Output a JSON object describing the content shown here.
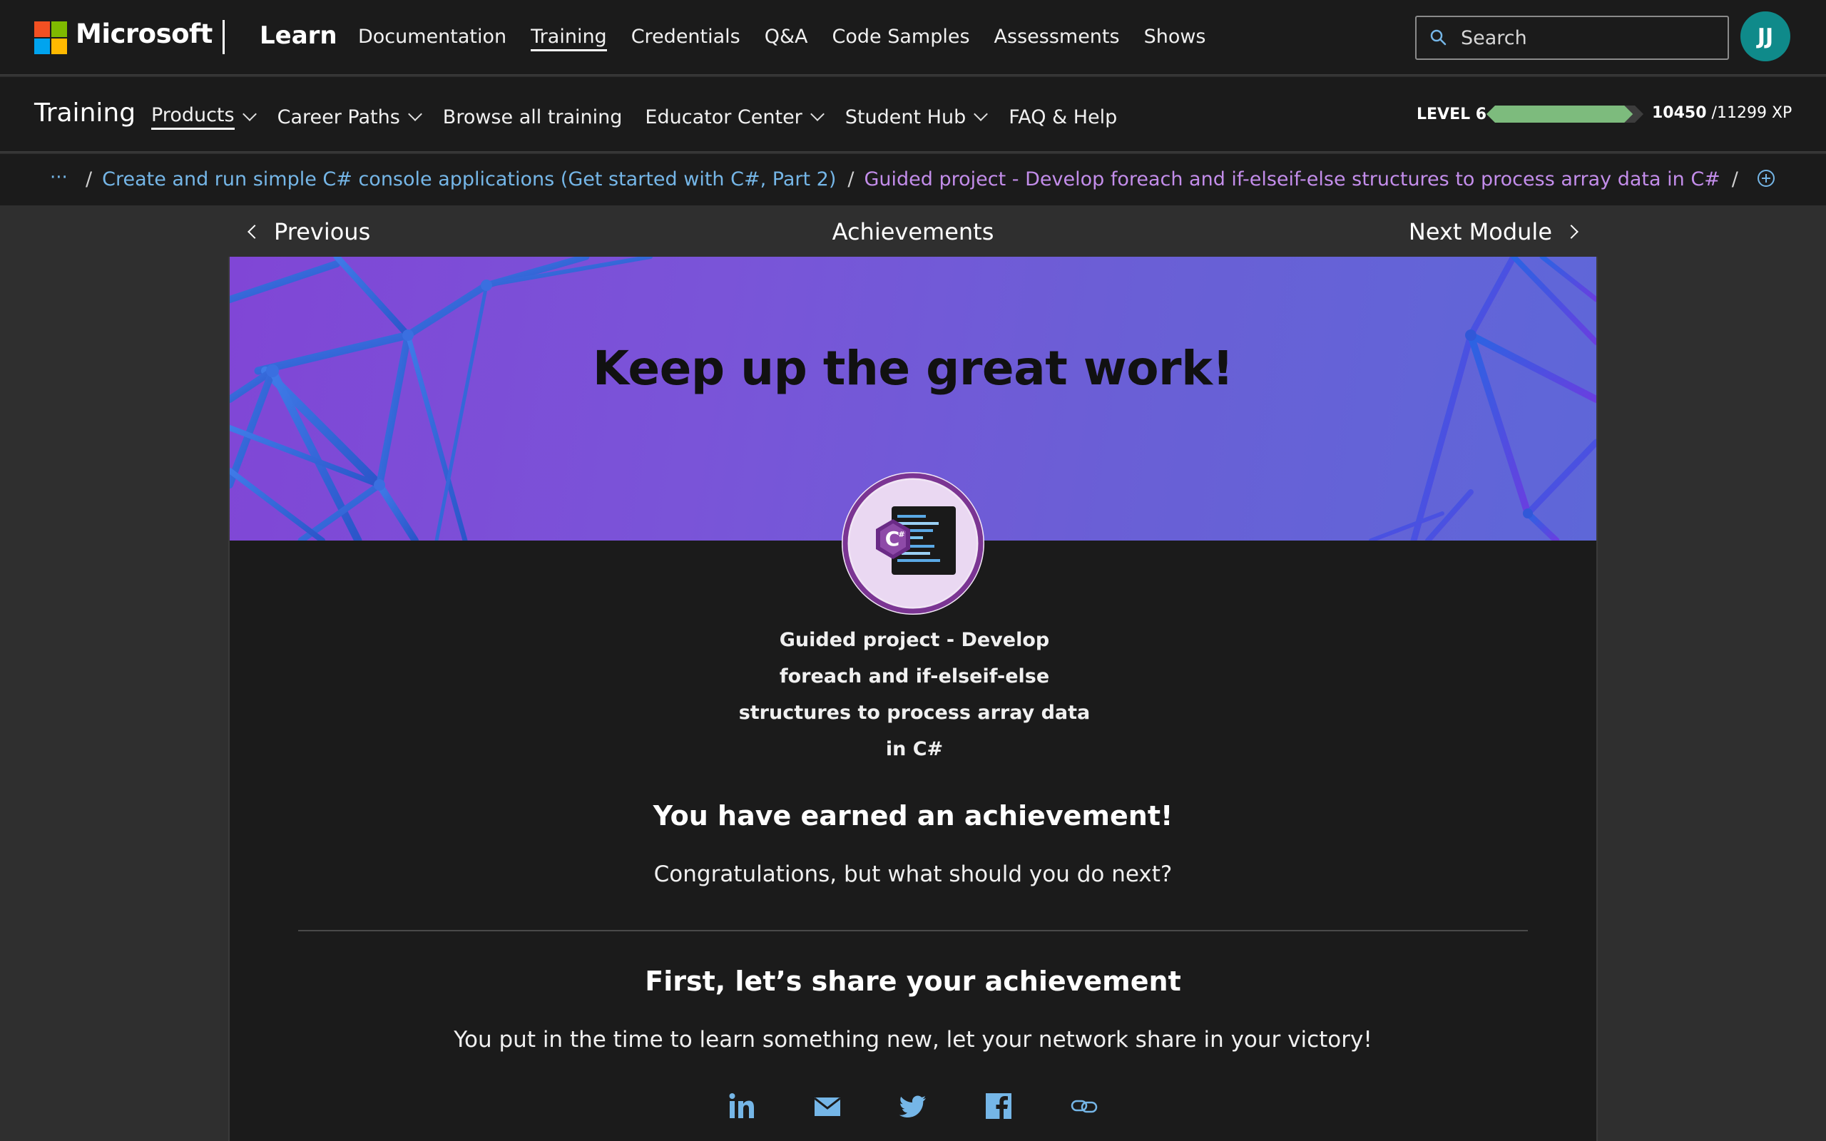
{
  "header": {
    "brand": "Microsoft",
    "product": "Learn",
    "nav": [
      "Documentation",
      "Training",
      "Credentials",
      "Q&A",
      "Code Samples",
      "Assessments",
      "Shows"
    ],
    "active_nav": "Training",
    "search_placeholder": "Search",
    "avatar_initials": "JJ",
    "logo_colors": [
      "#f25022",
      "#7fba00",
      "#00a4ef",
      "#ffb900"
    ]
  },
  "subheader": {
    "title": "Training",
    "items": [
      {
        "label": "Products",
        "dropdown": true,
        "active": true
      },
      {
        "label": "Career Paths",
        "dropdown": true
      },
      {
        "label": "Browse all training",
        "dropdown": false
      },
      {
        "label": "Educator Center",
        "dropdown": true
      },
      {
        "label": "Student Hub",
        "dropdown": true
      },
      {
        "label": "FAQ & Help",
        "dropdown": false
      }
    ],
    "level_label": "LEVEL 6",
    "xp_current": "10450",
    "xp_total": "/11299 XP",
    "xp_fraction": 0.925,
    "xp_color": "#7dbb7d"
  },
  "breadcrumb": {
    "ellipsis": "···",
    "separator": "/",
    "link": "Create and run simple C# console applications (Get started with C#, Part 2)",
    "current": "Guided project - Develop foreach and if-elseif-else structures to process array data in C#",
    "trailing_separator": "/"
  },
  "module_nav": {
    "previous": "Previous",
    "title": "Achievements",
    "next": "Next Module"
  },
  "achievement": {
    "banner_title": "Keep up the great work!",
    "badge_caption_lines": [
      "Guided project - Develop",
      "foreach and if-elseif-else",
      "structures to process array data",
      "in C#"
    ],
    "earned_heading": "You have earned an achievement!",
    "congrats_text": "Congratulations, but what should you do next?",
    "share_heading": "First, let’s share your achievement",
    "share_text": "You put in the time to learn something new, let your network share in your victory!",
    "share_icons": [
      "linkedin-icon",
      "email-icon",
      "twitter-icon",
      "facebook-icon",
      "copy-link-icon"
    ],
    "share_icon_color": "#75b6e7"
  }
}
